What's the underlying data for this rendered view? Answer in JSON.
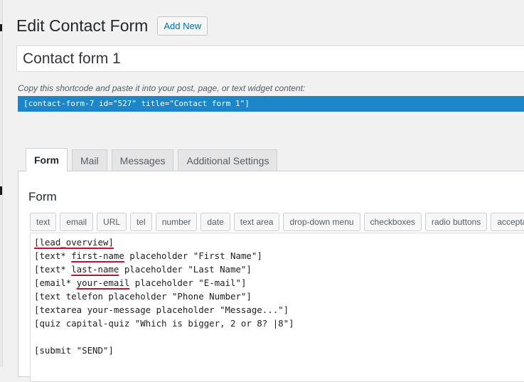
{
  "page": {
    "title": "Edit Contact Form",
    "add_new_label": "Add New"
  },
  "form_title": {
    "value": "Contact form 1"
  },
  "shortcode": {
    "hint": "Copy this shortcode and paste it into your post, page, or text widget content:",
    "code": "[contact-form-7 id=\"527\" title=\"Contact form 1\"]"
  },
  "tabs": [
    {
      "label": "Form",
      "active": true
    },
    {
      "label": "Mail",
      "active": false
    },
    {
      "label": "Messages",
      "active": false
    },
    {
      "label": "Additional Settings",
      "active": false
    }
  ],
  "panel": {
    "title": "Form"
  },
  "tag_buttons": [
    "text",
    "email",
    "URL",
    "tel",
    "number",
    "date",
    "text area",
    "drop-down menu",
    "checkboxes",
    "radio buttons",
    "acceptance"
  ],
  "code_lines": [
    {
      "pre": "",
      "highlight": "[lead_overview]",
      "post": ""
    },
    {
      "pre": "[text* ",
      "highlight": "first-name",
      "post": " placeholder \"First Name\"]"
    },
    {
      "pre": "[text* ",
      "highlight": "last-name",
      "post": " placeholder \"Last Name\"]"
    },
    {
      "pre": "[email* ",
      "highlight": "your-email",
      "post": " placeholder \"E-mail\"]"
    },
    {
      "pre": "[text telefon placeholder \"Phone Number\"]",
      "highlight": "",
      "post": ""
    },
    {
      "pre": "[textarea your-message placeholder \"Message...\"]",
      "highlight": "",
      "post": ""
    },
    {
      "pre": "[quiz capital-quiz \"Which is bigger, 2 or 8? |8\"]",
      "highlight": "",
      "post": ""
    },
    {
      "pre": "",
      "highlight": "",
      "post": ""
    },
    {
      "pre": "[submit \"SEND\"]",
      "highlight": "",
      "post": ""
    }
  ],
  "colors": {
    "accent_blue": "#1d86c8",
    "link_blue": "#0071a1",
    "underline_red": "#c8102e"
  }
}
